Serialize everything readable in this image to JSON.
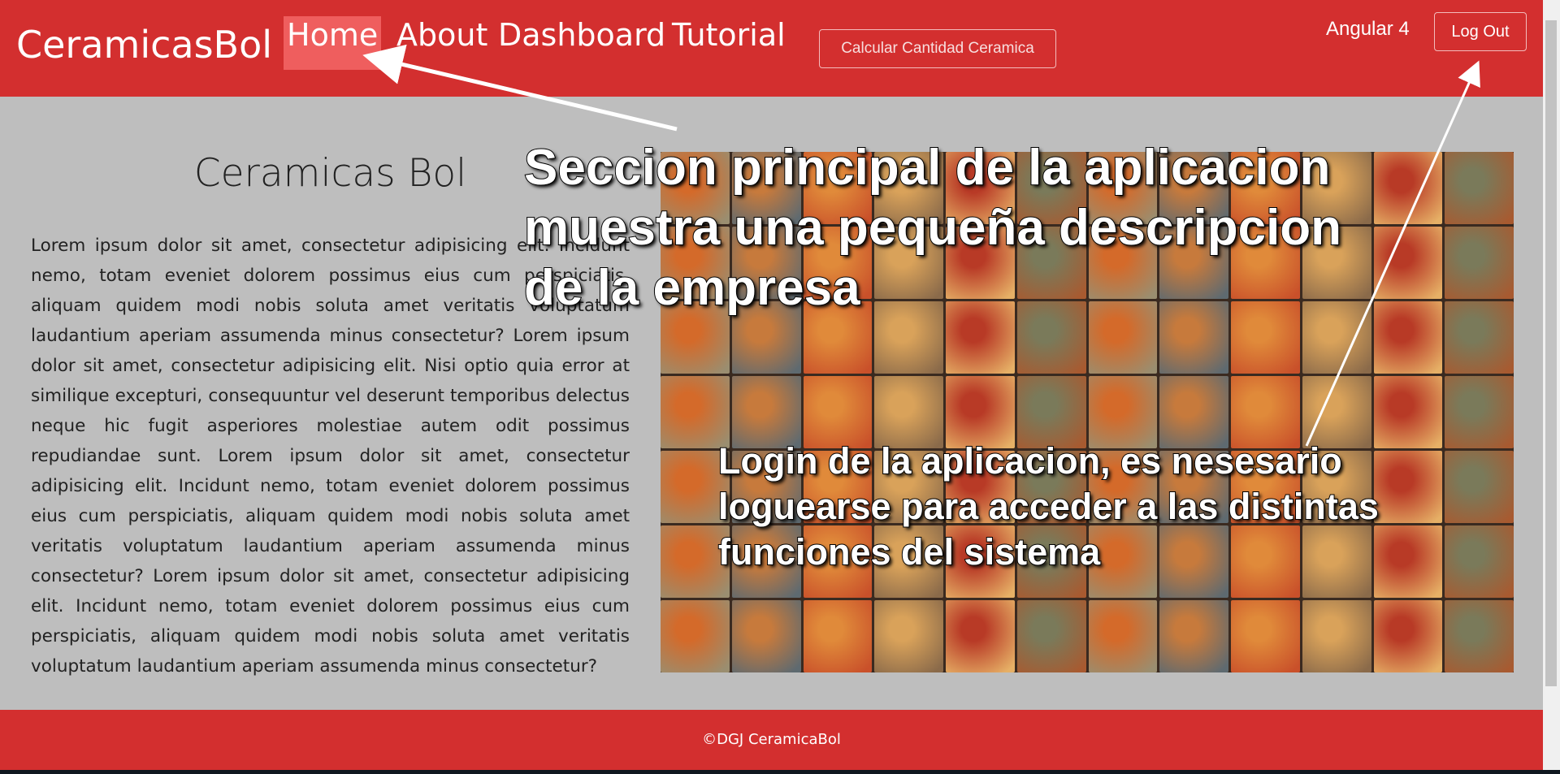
{
  "navbar": {
    "brand": "CeramicasBol",
    "links": [
      {
        "label": "Home",
        "active": true
      },
      {
        "label": "About"
      },
      {
        "label": "Dashboard"
      },
      {
        "label": "Tutorial"
      }
    ],
    "calc_button": "Calcular Cantidad Ceramica",
    "version": "Angular 4",
    "logout_button": "Log Out",
    "color": "#d32f2f"
  },
  "main": {
    "title": "Ceramicas Bol",
    "description": "Lorem ipsum dolor sit amet, consectetur adipisicing elit. Incidunt nemo, totam eveniet dolorem possimus eius cum perspiciatis, aliquam quidem modi nobis soluta amet veritatis voluptatum laudantium aperiam assumenda minus consectetur? Lorem ipsum dolor sit amet, consectetur adipisicing elit. Nisi optio quia error at similique excepturi, consequuntur vel deserunt temporibus delectus neque hic fugit asperiores molestiae autem odit possimus repudiandae sunt. Lorem ipsum dolor sit amet, consectetur adipisicing elit. Incidunt nemo, totam eveniet dolorem possimus eius cum perspiciatis, aliquam quidem modi nobis soluta amet veritatis voluptatum laudantium aperiam assumenda minus consectetur? Lorem ipsum dolor sit amet, consectetur adipisicing elit. Incidunt nemo, totam eveniet dolorem possimus eius cum perspiciatis, aliquam quidem modi nobis soluta amet veritatis voluptatum laudantium aperiam assumenda minus consectetur?",
    "image": "ceramic-leaf-tiles"
  },
  "annotations": {
    "main_section": "Seccion principal de la aplicacion\nmuestra una pequeña descripcion\nde la empresa",
    "login": "Login de la aplicacion, es nesesario\nloguearse para acceder a las distintas\nfunciones del sistema"
  },
  "footer": {
    "text": "©DGJ CeramicaBol"
  }
}
